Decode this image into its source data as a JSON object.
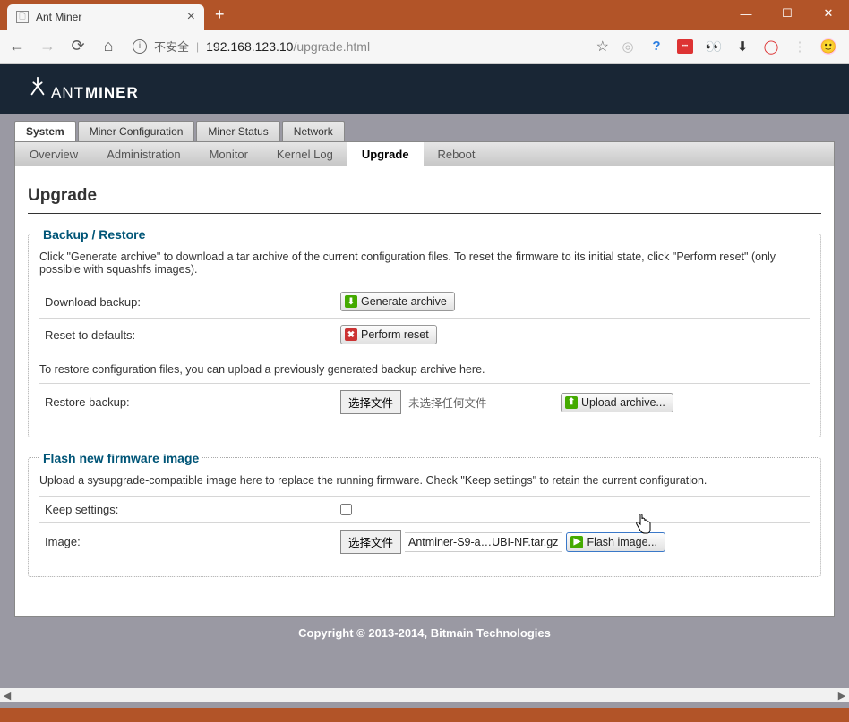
{
  "window": {
    "tab_title": "Ant Miner",
    "security_warning": "不安全",
    "url_host": "192.168.123.10",
    "url_path": "/upgrade.html"
  },
  "brand": {
    "part1": "ANT",
    "part2": "MINER"
  },
  "main_tabs": [
    "System",
    "Miner Configuration",
    "Miner Status",
    "Network"
  ],
  "main_tab_active": 0,
  "sub_tabs": [
    "Overview",
    "Administration",
    "Monitor",
    "Kernel Log",
    "Upgrade",
    "Reboot"
  ],
  "sub_tab_active": 4,
  "page_title": "Upgrade",
  "backup": {
    "legend": "Backup / Restore",
    "desc": "Click \"Generate archive\" to download a tar archive of the current configuration files. To reset the firmware to its initial state, click \"Perform reset\" (only possible with squashfs images).",
    "download_label": "Download backup:",
    "generate_btn": "Generate archive",
    "reset_label": "Reset to defaults:",
    "reset_btn": "Perform reset",
    "restore_desc": "To restore configuration files, you can upload a previously generated backup archive here.",
    "restore_label": "Restore backup:",
    "choose_file_btn": "选择文件",
    "no_file_text": "未选择任何文件",
    "upload_btn": "Upload archive..."
  },
  "flash": {
    "legend": "Flash new firmware image",
    "desc": "Upload a sysupgrade-compatible image here to replace the running firmware. Check \"Keep settings\" to retain the current configuration.",
    "keep_label": "Keep settings:",
    "keep_checked": false,
    "image_label": "Image:",
    "choose_file_btn": "选择文件",
    "selected_file": "Antminer-S9-a…UBI-NF.tar.gz",
    "flash_btn": "Flash image..."
  },
  "footer": "Copyright © 2013-2014, Bitmain Technologies"
}
